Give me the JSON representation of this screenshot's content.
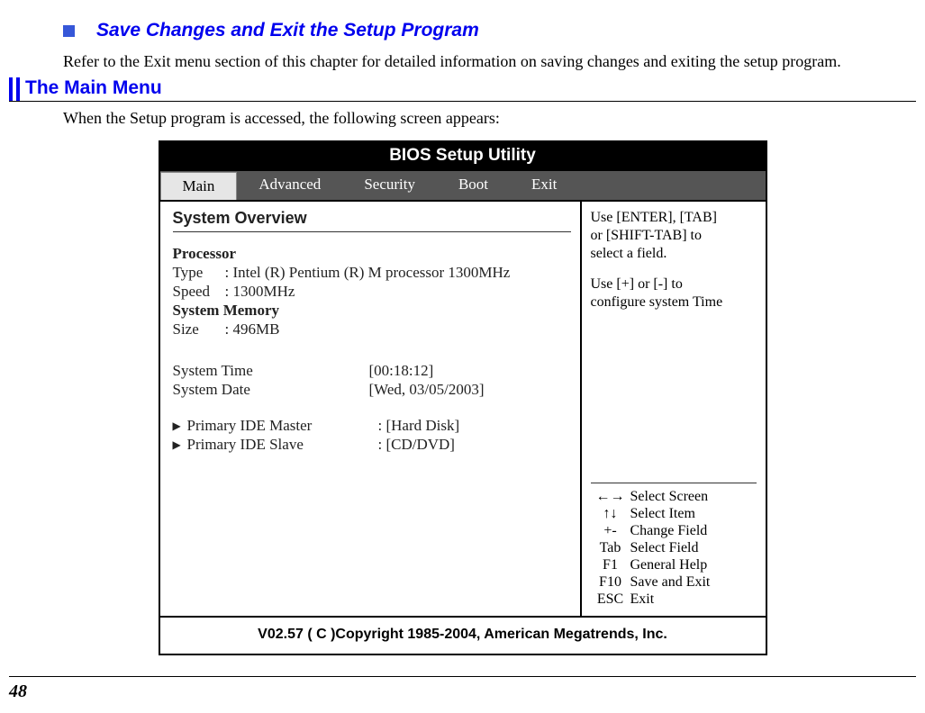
{
  "section1": {
    "heading": "Save Changes and Exit the Setup Program",
    "paragraph": "Refer to the Exit menu section of this chapter for detailed information on saving changes and exiting the setup program."
  },
  "section2": {
    "title": "The Main Menu",
    "paragraph": "When the Setup program is accessed, the following screen appears:"
  },
  "bios": {
    "title": "BIOS Setup Utility",
    "tabs": [
      "Main",
      "Advanced",
      "Security",
      "Boot",
      "Exit"
    ],
    "overview": "System Overview",
    "processor_label": "Processor",
    "type_label": "Type",
    "type_value": ": Intel (R)  Pentium (R)  M processor 1300MHz",
    "speed_label": "Speed",
    "speed_value": ": 1300MHz",
    "memory_label": "System Memory",
    "size_label": "Size",
    "size_value": ": 496MB",
    "time_label": "System Time",
    "time_value": "[00:18:12]",
    "date_label": "System Date",
    "date_value": "[Wed, 03/05/2003]",
    "ide_master_label": "Primary IDE Master",
    "ide_master_value": ": [Hard Disk]",
    "ide_slave_label": "Primary IDE Slave",
    "ide_slave_value": ": [CD/DVD]",
    "help_top1": "Use [ENTER], [TAB]",
    "help_top2": "or [SHIFT-TAB] to",
    "help_top3": "select a field.",
    "help_top4": "Use [+] or [-] to",
    "help_top5": "configure system Time",
    "help_rows": [
      {
        "sym": "←→",
        "text": "Select Screen"
      },
      {
        "sym": "↑↓",
        "text": "Select Item"
      },
      {
        "sym": "+-",
        "text": "Change Field"
      },
      {
        "sym": "Tab",
        "text": "Select Field"
      },
      {
        "sym": "F1",
        "text": "General Help"
      },
      {
        "sym": "F10",
        "text": "Save and Exit"
      },
      {
        "sym": "ESC",
        "text": "Exit"
      }
    ],
    "footer": "V02.57 ( C )Copyright 1985-2004, American Megatrends, Inc."
  },
  "page_number": "48"
}
